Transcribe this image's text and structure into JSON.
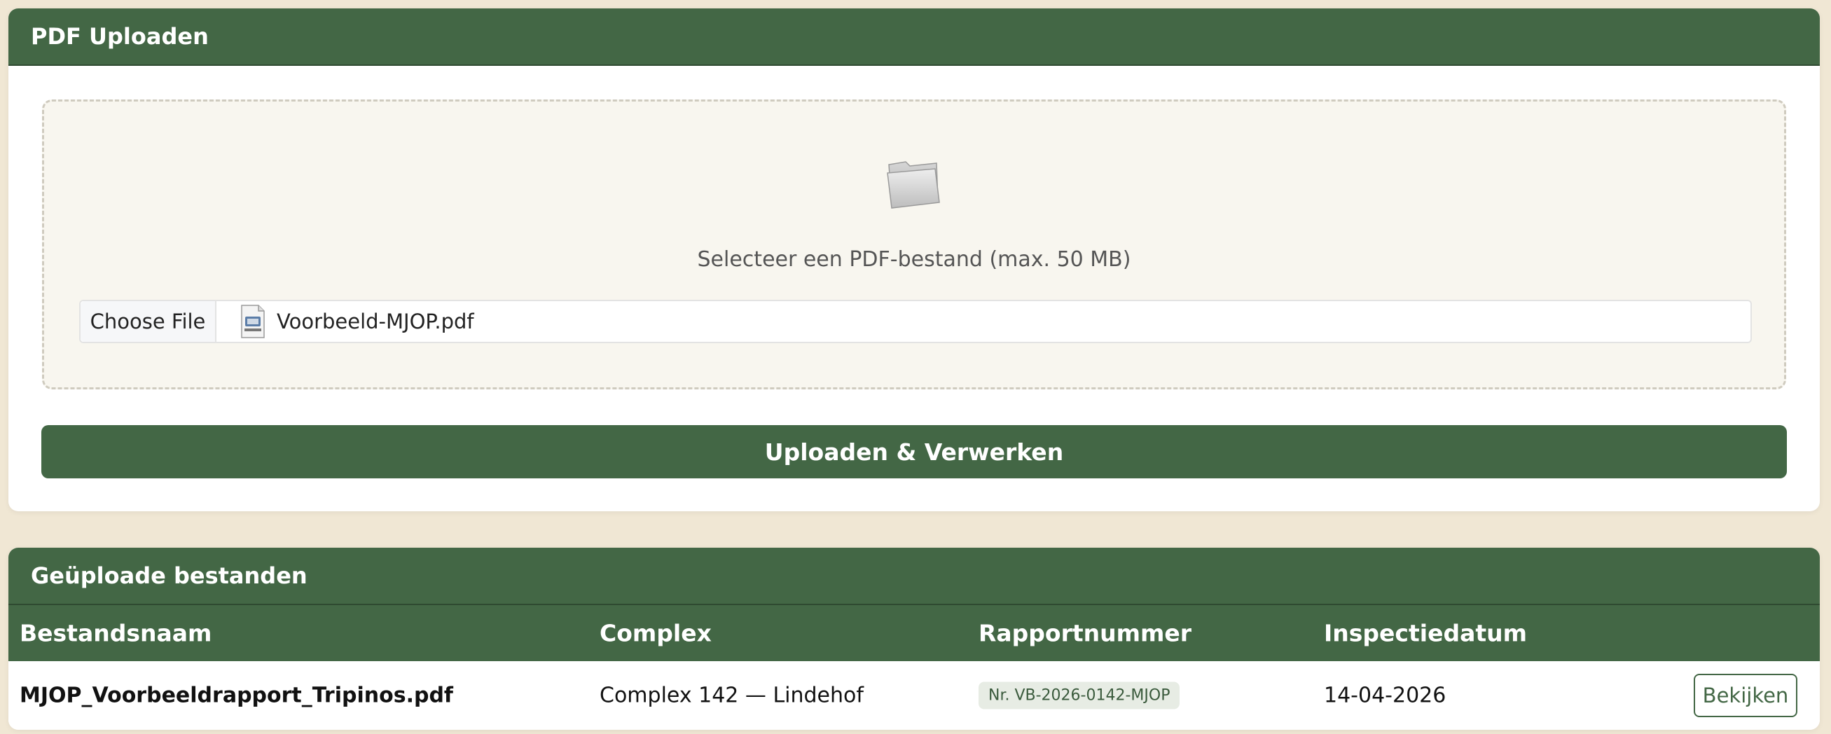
{
  "upload_card": {
    "title": "PDF Uploaden",
    "drop_text": "Selecteer een PDF-bestand (max. 50 MB)",
    "choose_file_label": "Choose File",
    "selected_file": "Voorbeeld-MJOP.pdf",
    "submit_label": "Uploaden & Verwerken"
  },
  "files_card": {
    "title": "Geüploade bestanden",
    "columns": [
      "Bestandsnaam",
      "Complex",
      "Rapportnummer",
      "Inspectiedatum"
    ],
    "rows": [
      {
        "filename": "MJOP_Voorbeeldrapport_Tripinos.pdf",
        "complex": "Complex 142 — Lindehof",
        "report_number": "Nr. VB-2026-0142-MJOP",
        "inspection_date": "14-04-2026",
        "action_label": "Bekijken"
      }
    ]
  },
  "colors": {
    "primary": "#436745",
    "background": "#f0e7d4",
    "dropzone": "#f8f6ef"
  }
}
